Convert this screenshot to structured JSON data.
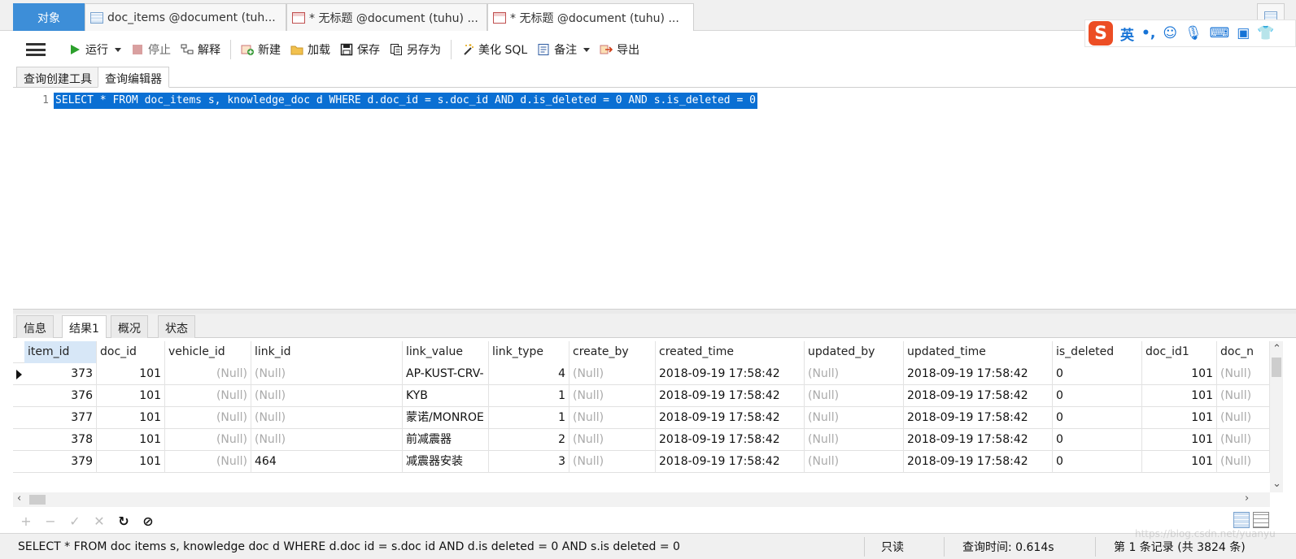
{
  "tabs": {
    "objects": "对象",
    "items": [
      "doc_items @document (tuh...",
      "* 无标题 @document (tuhu) ...",
      "* 无标题 @document (tuhu) ..."
    ]
  },
  "toolbar": {
    "run": "运行",
    "stop": "停止",
    "explain": "解释",
    "new": "新建",
    "load": "加载",
    "save": "保存",
    "save_as": "另存为",
    "beautify": "美化 SQL",
    "notes": "备注",
    "export": "导出"
  },
  "ime": {
    "lang": "英",
    "punct": "•,",
    "logo": "S"
  },
  "editor_tabs": [
    "查询创建工具",
    "查询编辑器"
  ],
  "editor": {
    "line": "1",
    "sql": "SELECT * FROM doc_items s, knowledge_doc d WHERE d.doc_id = s.doc_id AND d.is_deleted = 0 AND s.is_deleted = 0"
  },
  "result_tabs": [
    "信息",
    "结果1",
    "概况",
    "状态"
  ],
  "grid": {
    "columns": [
      "item_id",
      "doc_id",
      "vehicle_id",
      "link_id",
      "link_value",
      "link_type",
      "create_by",
      "created_time",
      "updated_by",
      "updated_time",
      "is_deleted",
      "doc_id1",
      "doc_n"
    ],
    "rows": [
      [
        "373",
        "101",
        "(Null)",
        "(Null)",
        "AP-KUST-CRV-",
        "4",
        "(Null)",
        "2018-09-19 17:58:42",
        "(Null)",
        "2018-09-19 17:58:42",
        "0",
        "101",
        "(Null)"
      ],
      [
        "376",
        "101",
        "(Null)",
        "(Null)",
        "KYB",
        "1",
        "(Null)",
        "2018-09-19 17:58:42",
        "(Null)",
        "2018-09-19 17:58:42",
        "0",
        "101",
        "(Null)"
      ],
      [
        "377",
        "101",
        "(Null)",
        "(Null)",
        "蒙诺/MONROE",
        "1",
        "(Null)",
        "2018-09-19 17:58:42",
        "(Null)",
        "2018-09-19 17:58:42",
        "0",
        "101",
        "(Null)"
      ],
      [
        "378",
        "101",
        "(Null)",
        "(Null)",
        "前减震器",
        "2",
        "(Null)",
        "2018-09-19 17:58:42",
        "(Null)",
        "2018-09-19 17:58:42",
        "0",
        "101",
        "(Null)"
      ],
      [
        "379",
        "101",
        "(Null)",
        "464",
        "减震器安装",
        "3",
        "(Null)",
        "2018-09-19 17:58:42",
        "(Null)",
        "2018-09-19 17:58:42",
        "0",
        "101",
        "(Null)"
      ]
    ]
  },
  "nav": [
    "+",
    "−",
    "✓",
    "✕",
    "↻",
    "⊘"
  ],
  "status": {
    "sql": "SELECT * FROM doc items s, knowledge doc d WHERE d.doc id = s.doc id AND d.is deleted = 0 AND s.is deleted = 0",
    "readonly": "只读",
    "query_time": "查询时间: 0.614s",
    "records": "第 1 条记录 (共 3824 条)"
  },
  "watermark": "https://blog.csdn.net/yuanyu",
  "colors": {
    "accent": "#3d8ed8",
    "selection": "#0a6fd3",
    "null_text": "#aaaaaa"
  }
}
